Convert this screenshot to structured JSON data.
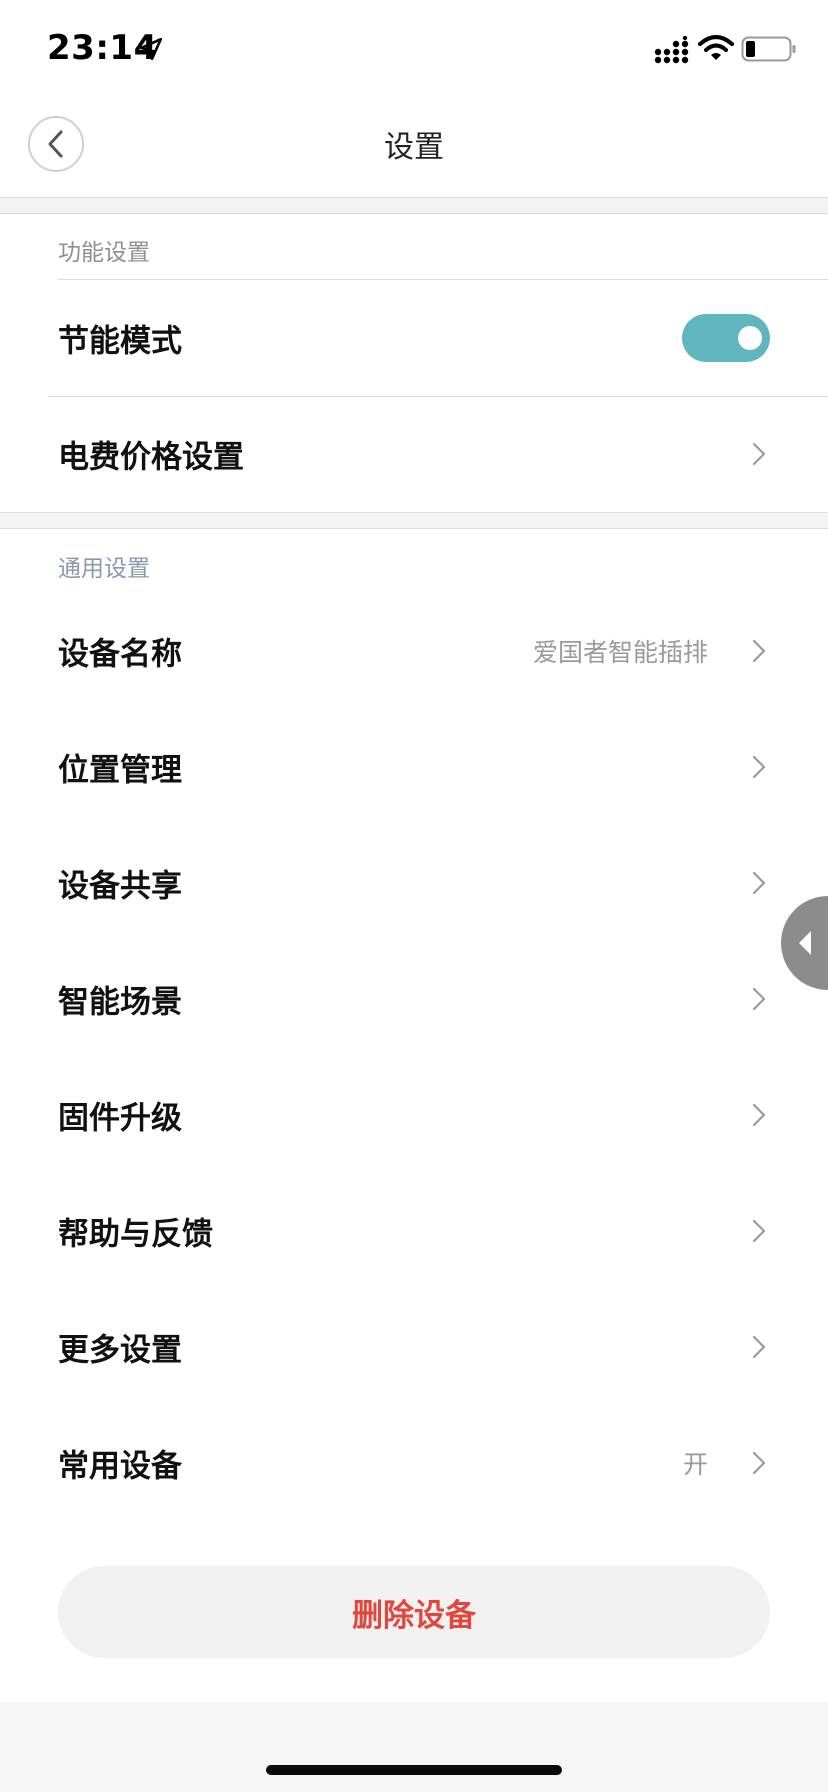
{
  "status_bar": {
    "time": "23:14"
  },
  "nav": {
    "title": "设置"
  },
  "function_settings": {
    "header": "功能设置",
    "items": [
      {
        "label": "节能模式",
        "toggle_on": true
      },
      {
        "label": "电费价格设置"
      }
    ]
  },
  "general_settings": {
    "header": "通用设置",
    "items": [
      {
        "label": "设备名称",
        "value": "爱国者智能插排"
      },
      {
        "label": "位置管理"
      },
      {
        "label": "设备共享"
      },
      {
        "label": "智能场景"
      },
      {
        "label": "固件升级"
      },
      {
        "label": "帮助与反馈"
      },
      {
        "label": "更多设置"
      },
      {
        "label": "常用设备",
        "value": "开"
      }
    ]
  },
  "delete_button": {
    "label": "删除设备"
  },
  "colors": {
    "accent": "#5fb6bf",
    "danger": "#e0473e"
  },
  "icons": [
    "location-arrow-icon",
    "signal-icon",
    "wifi-icon",
    "battery-icon",
    "back-arrow-icon",
    "chevron-right-icon",
    "handle-arrow-icon"
  ]
}
